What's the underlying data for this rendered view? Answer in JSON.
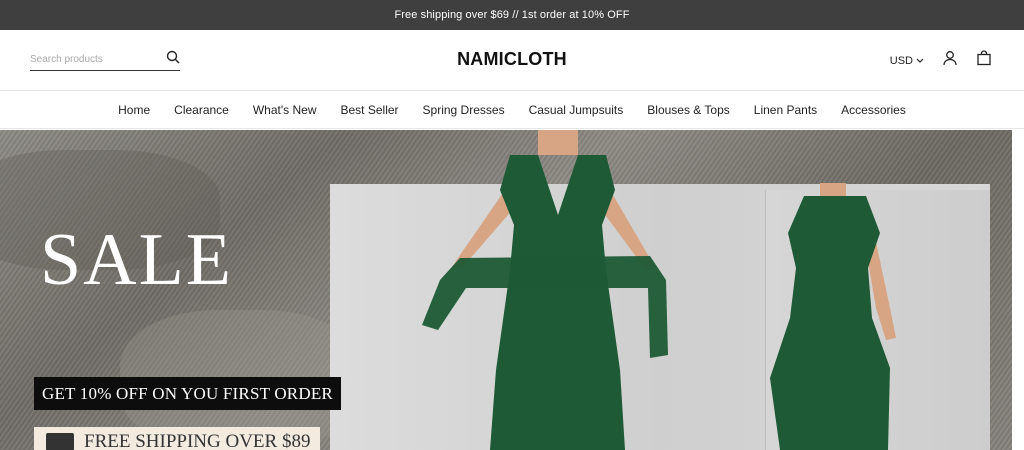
{
  "announcement": "Free shipping over $69 // 1st order at 10% OFF",
  "header": {
    "search_placeholder": "Search products",
    "brand": "NAMICLOTH",
    "currency": "USD"
  },
  "nav": {
    "items": [
      "Home",
      "Clearance",
      "What's New",
      "Best Seller",
      "Spring Dresses",
      "Casual Jumpsuits",
      "Blouses & Tops",
      "Linen Pants",
      "Accessories"
    ]
  },
  "hero": {
    "title": "SALE",
    "badge_primary": "GET 10% OFF ON YOU FIRST ORDER",
    "badge_secondary": "FREE SHIPPING OVER $89"
  },
  "icons": {
    "search": "search-icon",
    "user": "user-icon",
    "bag": "bag-icon",
    "chevron": "chevron-down-icon",
    "truck": "truck-icon"
  }
}
